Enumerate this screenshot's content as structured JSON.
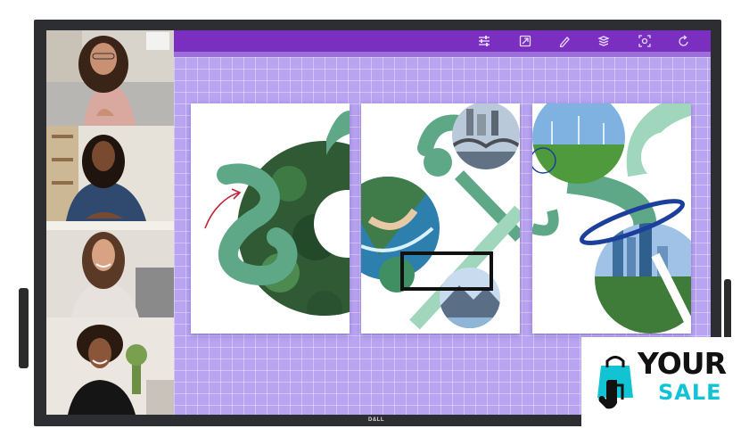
{
  "display": {
    "brand": "D&LL"
  },
  "video_call": {
    "participants": [
      {
        "label": "participant-1"
      },
      {
        "label": "participant-2"
      },
      {
        "label": "participant-3"
      },
      {
        "label": "participant-4"
      }
    ]
  },
  "whiteboard": {
    "toolbar": {
      "tools": [
        "settings-sliders-icon",
        "share-screen-icon",
        "pen-icon",
        "layers-icon",
        "capture-icon",
        "undo-icon"
      ]
    },
    "panels": [
      "panel-forest",
      "panel-coast",
      "panel-city"
    ],
    "colors": {
      "toolbar": "#7a2fc0",
      "canvas": "#b9a4f2",
      "shape_green": "#5ea887",
      "ink_blue": "#1d3f9c",
      "ink_red": "#c0273a"
    }
  },
  "badge": {
    "word1": "YOUR",
    "word2": "SALE",
    "accent": "#12c4d3"
  }
}
